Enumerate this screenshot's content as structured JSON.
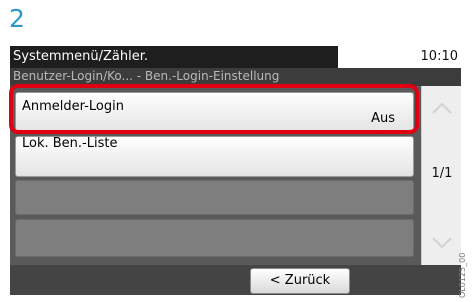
{
  "step_number": "2",
  "screen": {
    "title": "Systemmenü/Zähler.",
    "time": "10:10",
    "breadcrumb": "Benutzer-Login/Ko... - Ben.-Login-Einstellung"
  },
  "list": {
    "items": [
      {
        "label": "Anmelder-Login",
        "value": "Aus"
      },
      {
        "label": "Lok. Ben.-Liste",
        "value": ""
      }
    ]
  },
  "pagination": {
    "page_indicator": "1/1"
  },
  "footer": {
    "back_label": "< Zurück"
  },
  "side_code": "OL0125_00",
  "colors": {
    "step_number": "#2f97c9",
    "highlight": "#e00012",
    "title_bar": "#1e1e1e",
    "panel_background": "#5a5a5a"
  },
  "icons": {
    "scroll_up": "chevron-up-icon",
    "scroll_down": "chevron-down-icon"
  }
}
